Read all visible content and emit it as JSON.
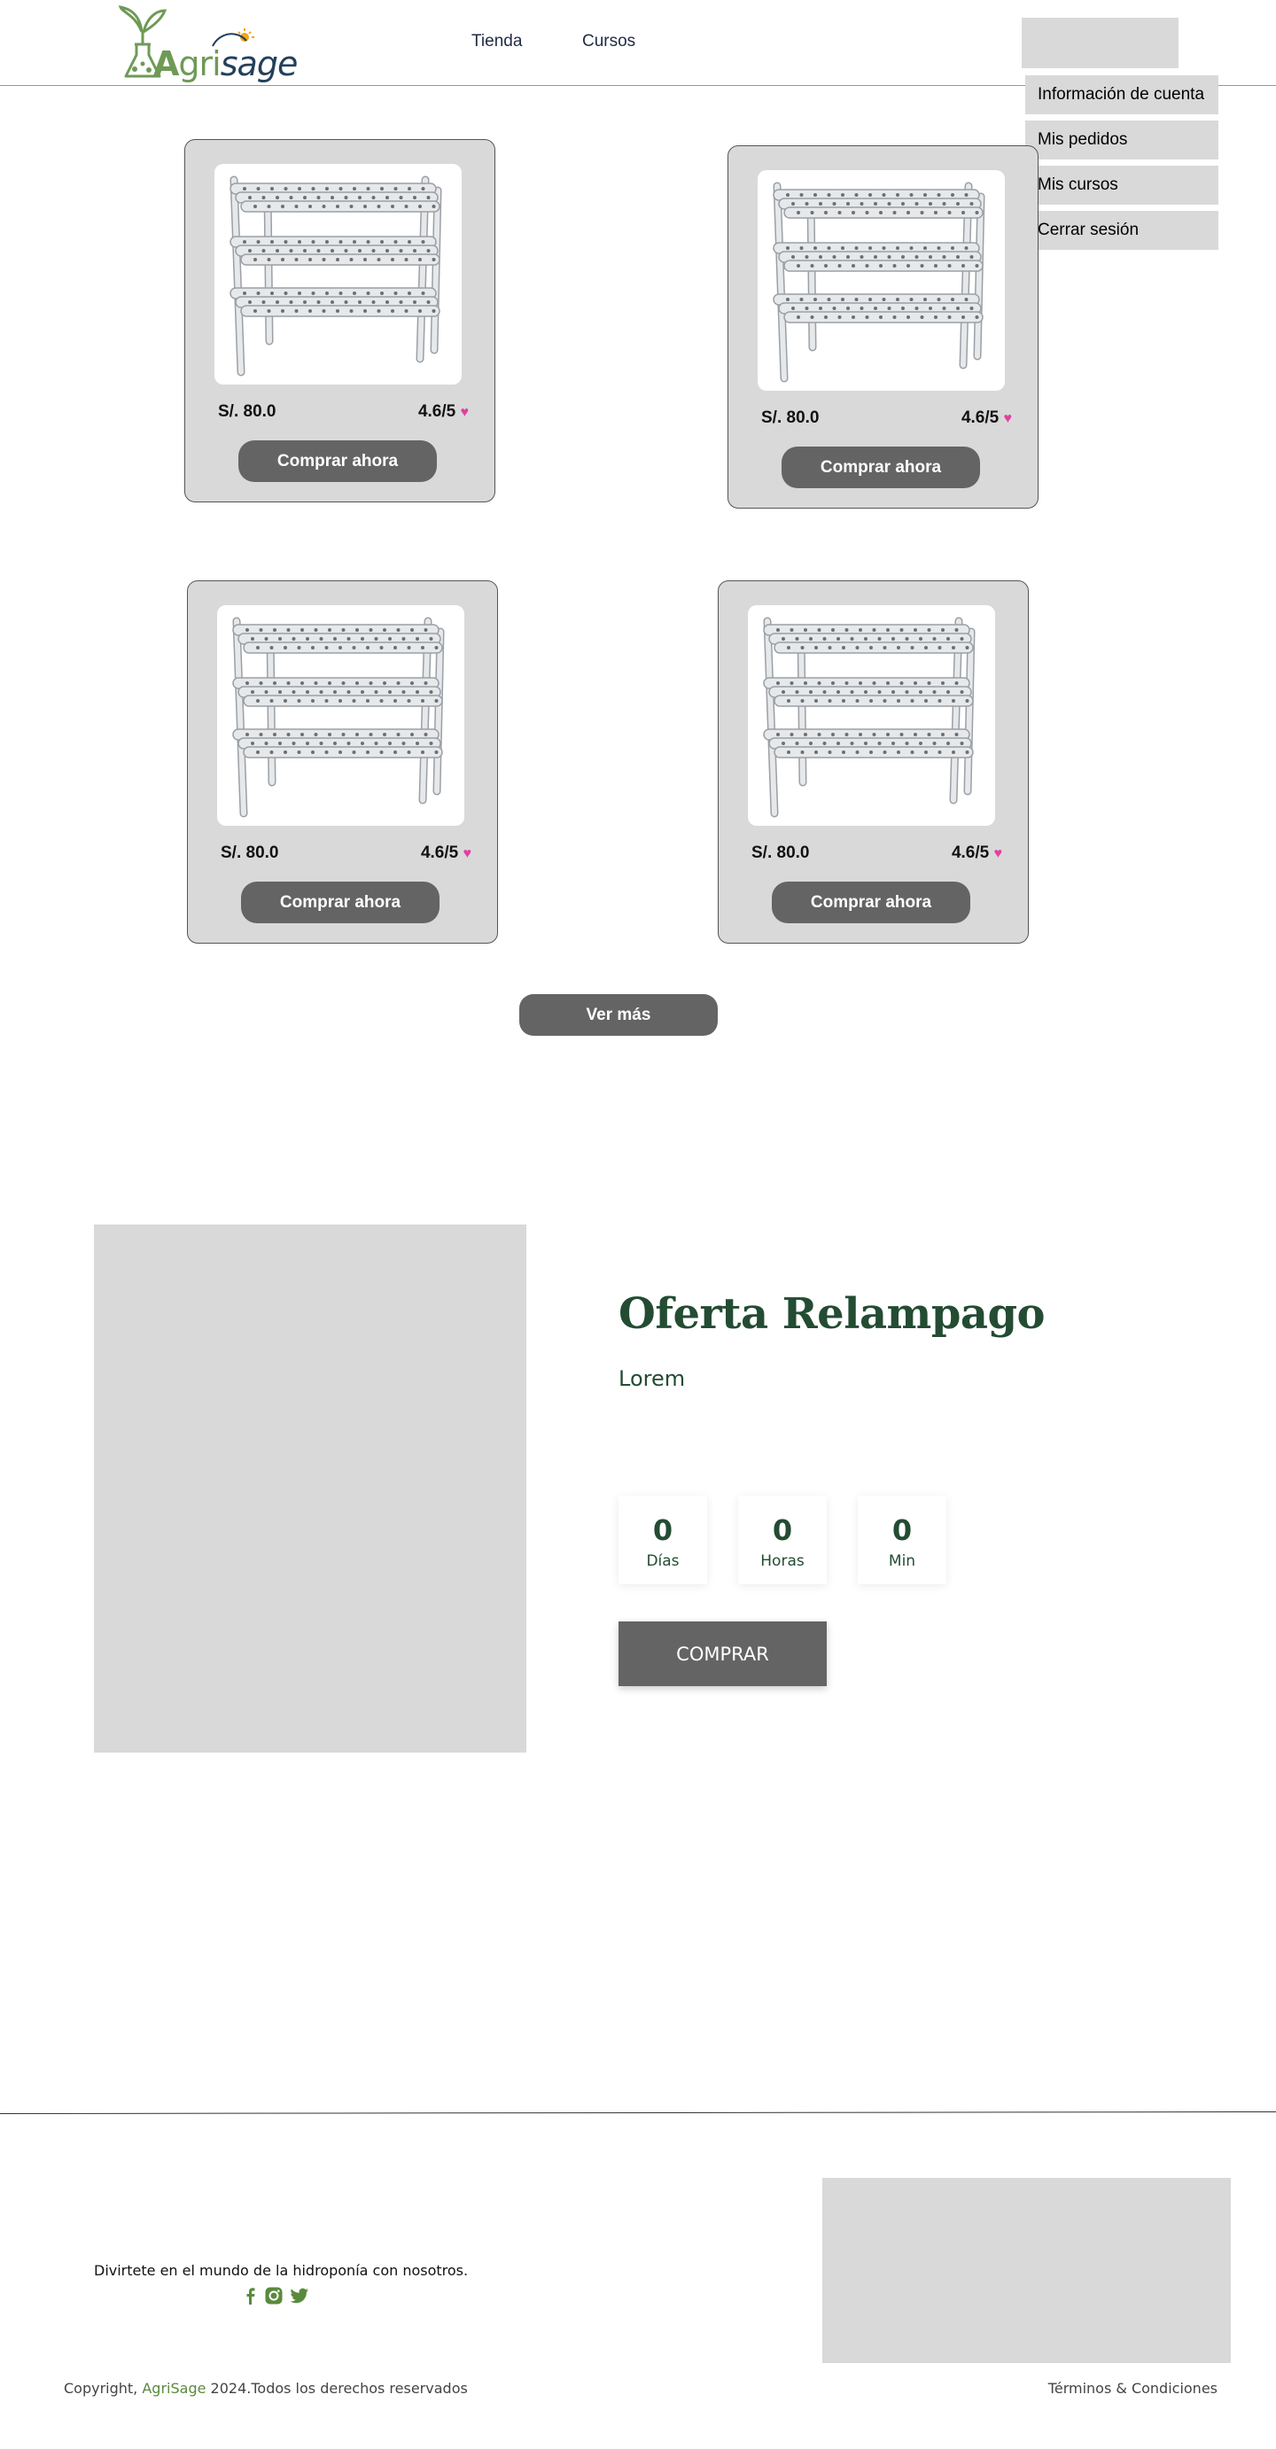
{
  "header": {
    "logo": {
      "a": "A",
      "gri": "gri",
      "sage": "sage"
    },
    "nav": [
      "Tienda",
      "Cursos"
    ]
  },
  "account_menu": {
    "items": [
      "Información de cuenta",
      "Mis pedidos",
      "Mis cursos",
      "Cerrar sesión"
    ]
  },
  "products": [
    {
      "price": "S/. 80.0",
      "rating": "4.6/5",
      "button": "Comprar ahora"
    },
    {
      "price": "S/. 80.0",
      "rating": "4.6/5",
      "button": "Comprar ahora"
    },
    {
      "price": "S/. 80.0",
      "rating": "4.6/5",
      "button": "Comprar ahora"
    },
    {
      "price": "S/. 80.0",
      "rating": "4.6/5",
      "button": "Comprar ahora"
    }
  ],
  "rating_icon": "heart-icon",
  "see_more": "Ver más",
  "offer": {
    "title": "Oferta Relampago",
    "subtitle": "Lorem",
    "countdown": [
      {
        "value": "0",
        "label": "Días"
      },
      {
        "value": "0",
        "label": "Horas"
      },
      {
        "value": "0",
        "label": "Min"
      }
    ],
    "buy_button": "COMPRAR"
  },
  "footer": {
    "tagline": "Divirtete en el mundo de la hidroponía con nosotros.",
    "social_icons": [
      "facebook-icon",
      "instagram-icon",
      "twitter-icon"
    ],
    "copyright_prefix": "Copyright, ",
    "copyright_brand": "AgriSage",
    "copyright_suffix": " 2024.Todos los derechos reservados",
    "terms": "Términos & Condiciones"
  },
  "colors": {
    "brand_green": "#6e9a56",
    "dark_green": "#234c33",
    "button_gray": "#646464",
    "panel_gray": "#d9d9d9",
    "heart": "#e33f9f"
  }
}
